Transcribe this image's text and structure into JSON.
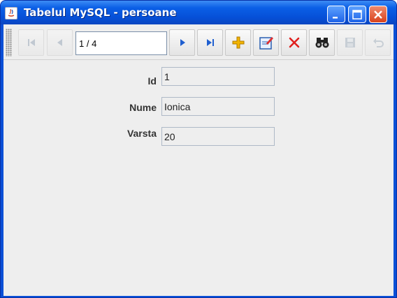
{
  "window": {
    "title": "Tabelul MySQL - persoane",
    "controls": [
      "minimize-icon",
      "maximize-icon",
      "close-icon"
    ]
  },
  "toolbar": {
    "record_position": "1 / 4",
    "buttons": [
      {
        "name": "first-record",
        "icon": "first-record-icon",
        "enabled": false
      },
      {
        "name": "previous-record",
        "icon": "previous-record-icon",
        "enabled": false
      },
      {
        "name": "next-record",
        "icon": "next-record-icon",
        "enabled": true
      },
      {
        "name": "last-record",
        "icon": "last-record-icon",
        "enabled": true
      },
      {
        "name": "insert-record",
        "icon": "plus-icon",
        "enabled": true
      },
      {
        "name": "edit-record",
        "icon": "edit-icon",
        "enabled": true
      },
      {
        "name": "delete-record",
        "icon": "delete-icon",
        "enabled": true
      },
      {
        "name": "find-record",
        "icon": "binoculars-icon",
        "enabled": true
      },
      {
        "name": "save-record",
        "icon": "save-icon",
        "enabled": false
      },
      {
        "name": "undo-record",
        "icon": "undo-icon",
        "enabled": false
      }
    ]
  },
  "form": {
    "fields": [
      {
        "label": "Id",
        "value": "1"
      },
      {
        "label": "Nume",
        "value": "Ionica"
      },
      {
        "label": "Varsta",
        "value": "20"
      }
    ]
  },
  "colors": {
    "titlebar": "#0650d8",
    "client_bg": "#eeeeee",
    "nav_arrow": "#1f5fd0",
    "plus": "#f2b400",
    "delete": "#e0201e"
  }
}
